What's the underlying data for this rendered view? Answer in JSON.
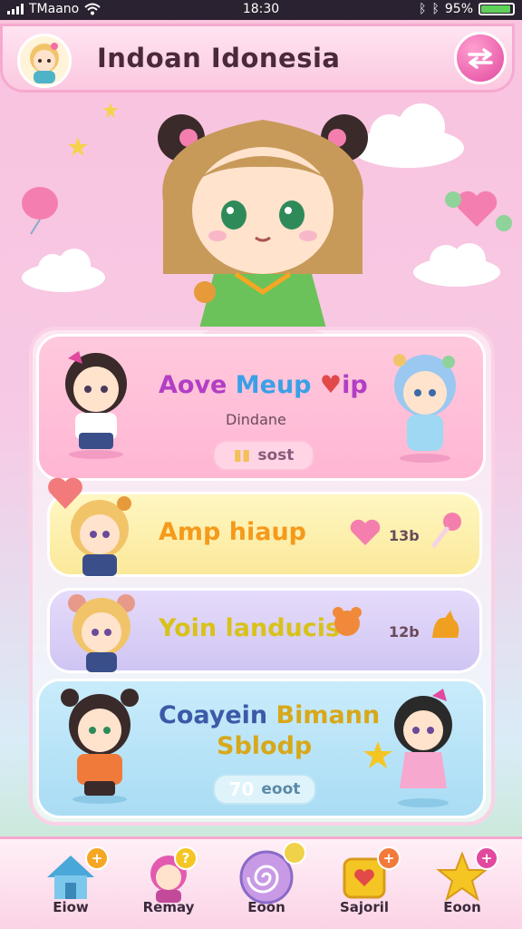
{
  "status_bar": {
    "carrier": "TMaano",
    "time": "18:30",
    "battery_percent": "95%",
    "battery_level": 0.95
  },
  "header": {
    "title": "Indoan Idonesia",
    "swap_icon": "swap-arrows-icon"
  },
  "cards": [
    {
      "title_a": "Aove ",
      "title_b": "Meup ",
      "title_c": "ip",
      "subtitle": "Dindane",
      "pill_text": "sost",
      "theme": "#ffb6d3"
    },
    {
      "title": "Amp hiaup",
      "count": "13b",
      "theme": "#fbe99a"
    },
    {
      "title": "Yoin landucis",
      "count": "12b",
      "theme": "#cfc5f3"
    },
    {
      "title_line1_a": "Coayein ",
      "title_line1_b": "Bimann",
      "title_line2": "Sblodp",
      "pill_value": "70",
      "pill_text": "eoot",
      "theme": "#a9dcf4"
    }
  ],
  "nav": [
    {
      "label": "Eiow",
      "icon": "house-icon",
      "badge": "+",
      "badge_color": "#f5a623"
    },
    {
      "label": "Remay",
      "icon": "character-icon",
      "badge": "?",
      "badge_color": "#f5c623"
    },
    {
      "label": "Eoon",
      "icon": "candy-swirl-icon",
      "badge": "",
      "badge_color": "#f0d24a"
    },
    {
      "label": "Sajoril",
      "icon": "treasure-box-icon",
      "badge": "+",
      "badge_color": "#f27a3a"
    },
    {
      "label": "Eoon",
      "icon": "star-icon",
      "badge": "+",
      "badge_color": "#e2489e"
    }
  ],
  "colors": {
    "accent_pink": "#e2489e",
    "title_purple": "#6a2a7a",
    "meup_blue": "#3aa0e6",
    "amp_orange": "#f59a1b",
    "yoin_yellow": "#d8c21a"
  }
}
